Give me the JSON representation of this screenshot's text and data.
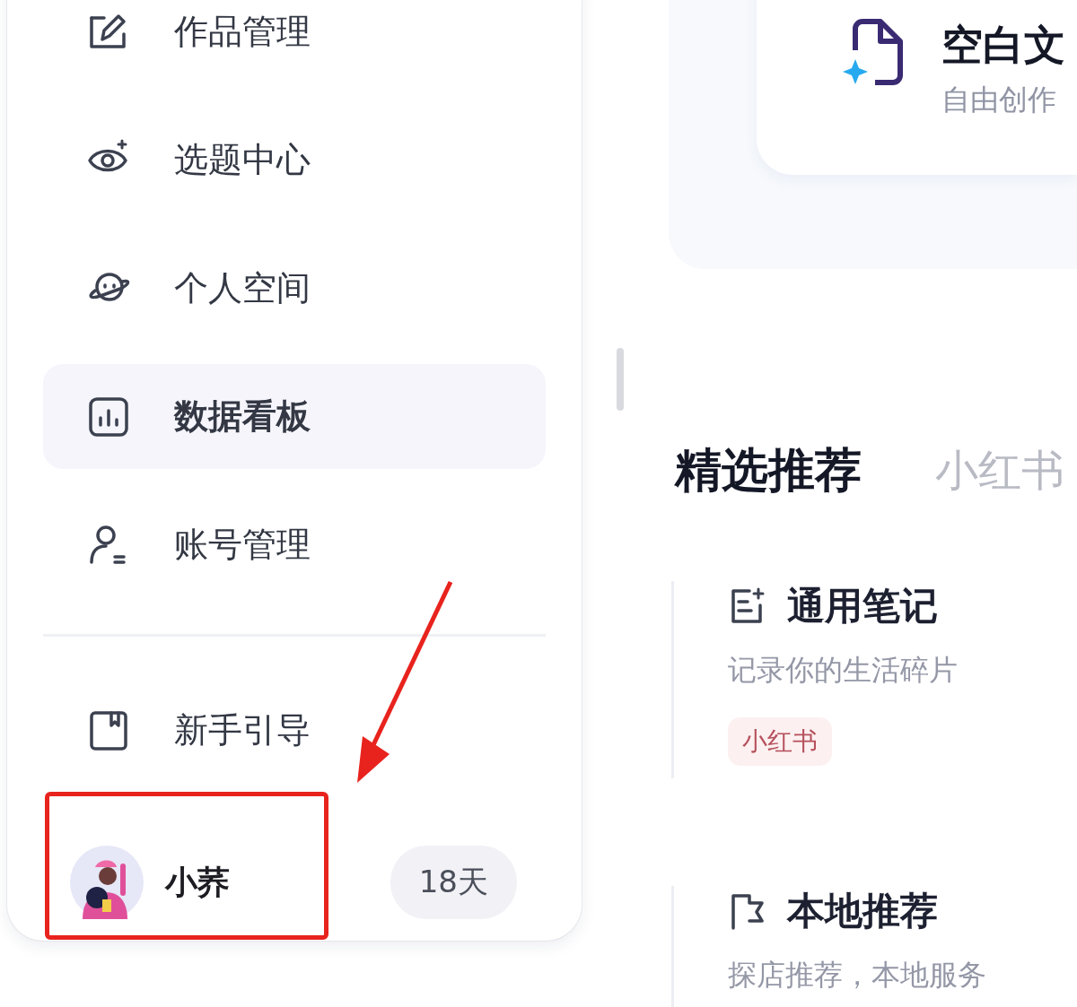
{
  "sidebar": {
    "items": [
      {
        "label": "作品管理",
        "selected": false
      },
      {
        "label": "选题中心",
        "selected": false
      },
      {
        "label": "个人空间",
        "selected": false
      },
      {
        "label": "数据看板",
        "selected": true
      },
      {
        "label": "账号管理",
        "selected": false
      }
    ],
    "footer_items": [
      {
        "label": "新手引导"
      }
    ],
    "user": {
      "name": "小荞",
      "badge": "18天"
    }
  },
  "create_card": {
    "title": "空白文",
    "subtitle": "自由创作"
  },
  "tabs": [
    {
      "label": "精选推荐",
      "selected": true
    },
    {
      "label": "小红书",
      "selected": false
    }
  ],
  "templates": [
    {
      "title": "通用笔记",
      "description": "记录你的生活碎片",
      "tags": [
        "小红书"
      ]
    },
    {
      "title": "本地推荐",
      "description": "探店推荐，本地服务"
    }
  ]
}
